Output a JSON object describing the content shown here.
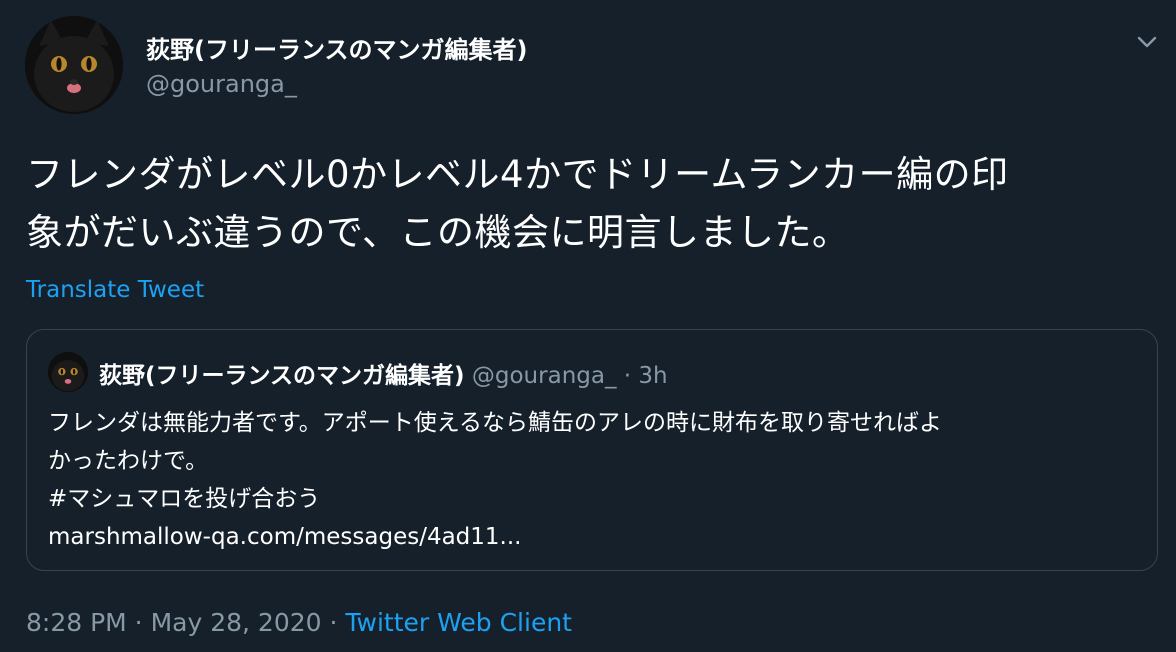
{
  "author": {
    "display_name": "荻野(フリーランスのマンガ編集者)",
    "handle": "@gouranga_"
  },
  "tweet": {
    "text_line1": "フレンダがレベル0かレベル4かでドリームランカー編の印",
    "text_line2": "象がだいぶ違うので、この機会に明言しました。",
    "translate_label": "Translate Tweet"
  },
  "quoted_tweet": {
    "display_name": "荻野(フリーランスのマンガ編集者)",
    "handle": "@gouranga_",
    "separator": "·",
    "time": "3h",
    "line1": "フレンダは無能力者です。アポート使えるなら鯖缶のアレの時に財布を取り寄せればよ",
    "line2": "かったわけで。",
    "line3": "#マシュマロを投げ合おう",
    "line4": "marshmallow-qa.com/messages/4ad11..."
  },
  "footer": {
    "time": "8:28 PM · May 28, 2020",
    "separator": "·",
    "client": "Twitter Web Client"
  },
  "colors": {
    "background": "#15202b",
    "text": "#ffffff",
    "secondary": "#8899a6",
    "link": "#1da1f2",
    "border": "#38444d"
  },
  "icons": {
    "menu": "chevron-down-icon"
  }
}
